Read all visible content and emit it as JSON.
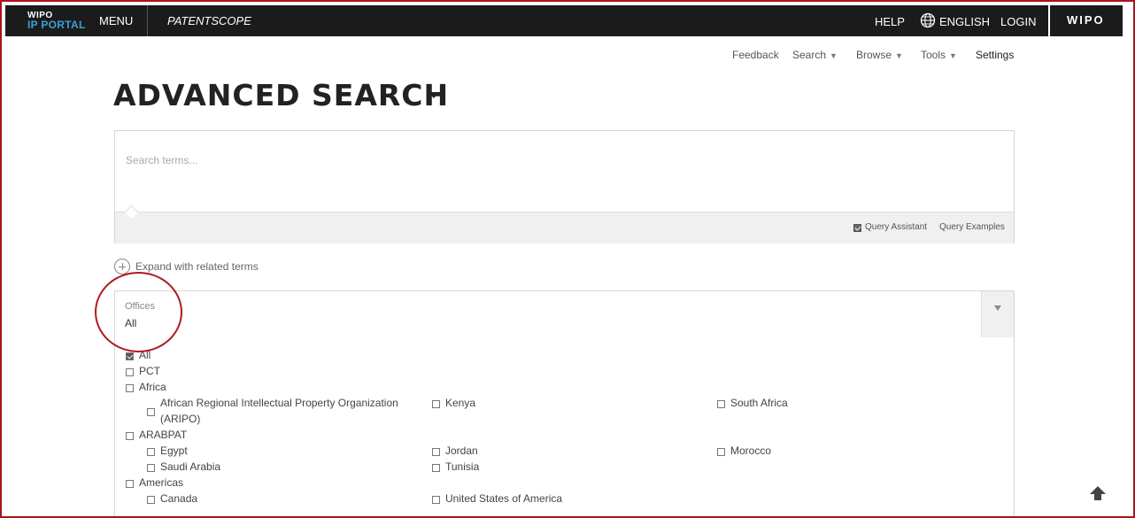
{
  "topbar": {
    "logo_line1": "WIPO",
    "logo_line2": "IP PORTAL",
    "menu": "MENU",
    "product": "PATENTSCOPE",
    "help": "HELP",
    "language": "ENGLISH",
    "login": "LOGIN",
    "brand": "WIPO"
  },
  "subnav": {
    "feedback": "Feedback",
    "search": "Search",
    "browse": "Browse",
    "tools": "Tools",
    "settings": "Settings"
  },
  "page_title": "ADVANCED SEARCH",
  "search": {
    "placeholder": "Search terms...",
    "query_assistant": "Query Assistant",
    "query_assistant_checked": true,
    "query_examples": "Query Examples"
  },
  "expand_related": "Expand with related terms",
  "offices": {
    "label": "Offices",
    "value": "All",
    "items": {
      "all": "All",
      "pct": "PCT",
      "africa": "Africa",
      "aripo_line1": "African Regional Intellectual Property Organization",
      "aripo_line2": "(ARIPO)",
      "kenya": "Kenya",
      "south_africa": "South Africa",
      "arabpat": "ARABPAT",
      "egypt": "Egypt",
      "jordan": "Jordan",
      "morocco": "Morocco",
      "saudi_arabia": "Saudi Arabia",
      "tunisia": "Tunisia",
      "americas": "Americas",
      "canada": "Canada",
      "usa": "United States of America"
    }
  },
  "colors": {
    "topbar_bg": "#1b1b1b",
    "logo_accent": "#3aa0d8",
    "annotation_red": "#b01a1f"
  }
}
